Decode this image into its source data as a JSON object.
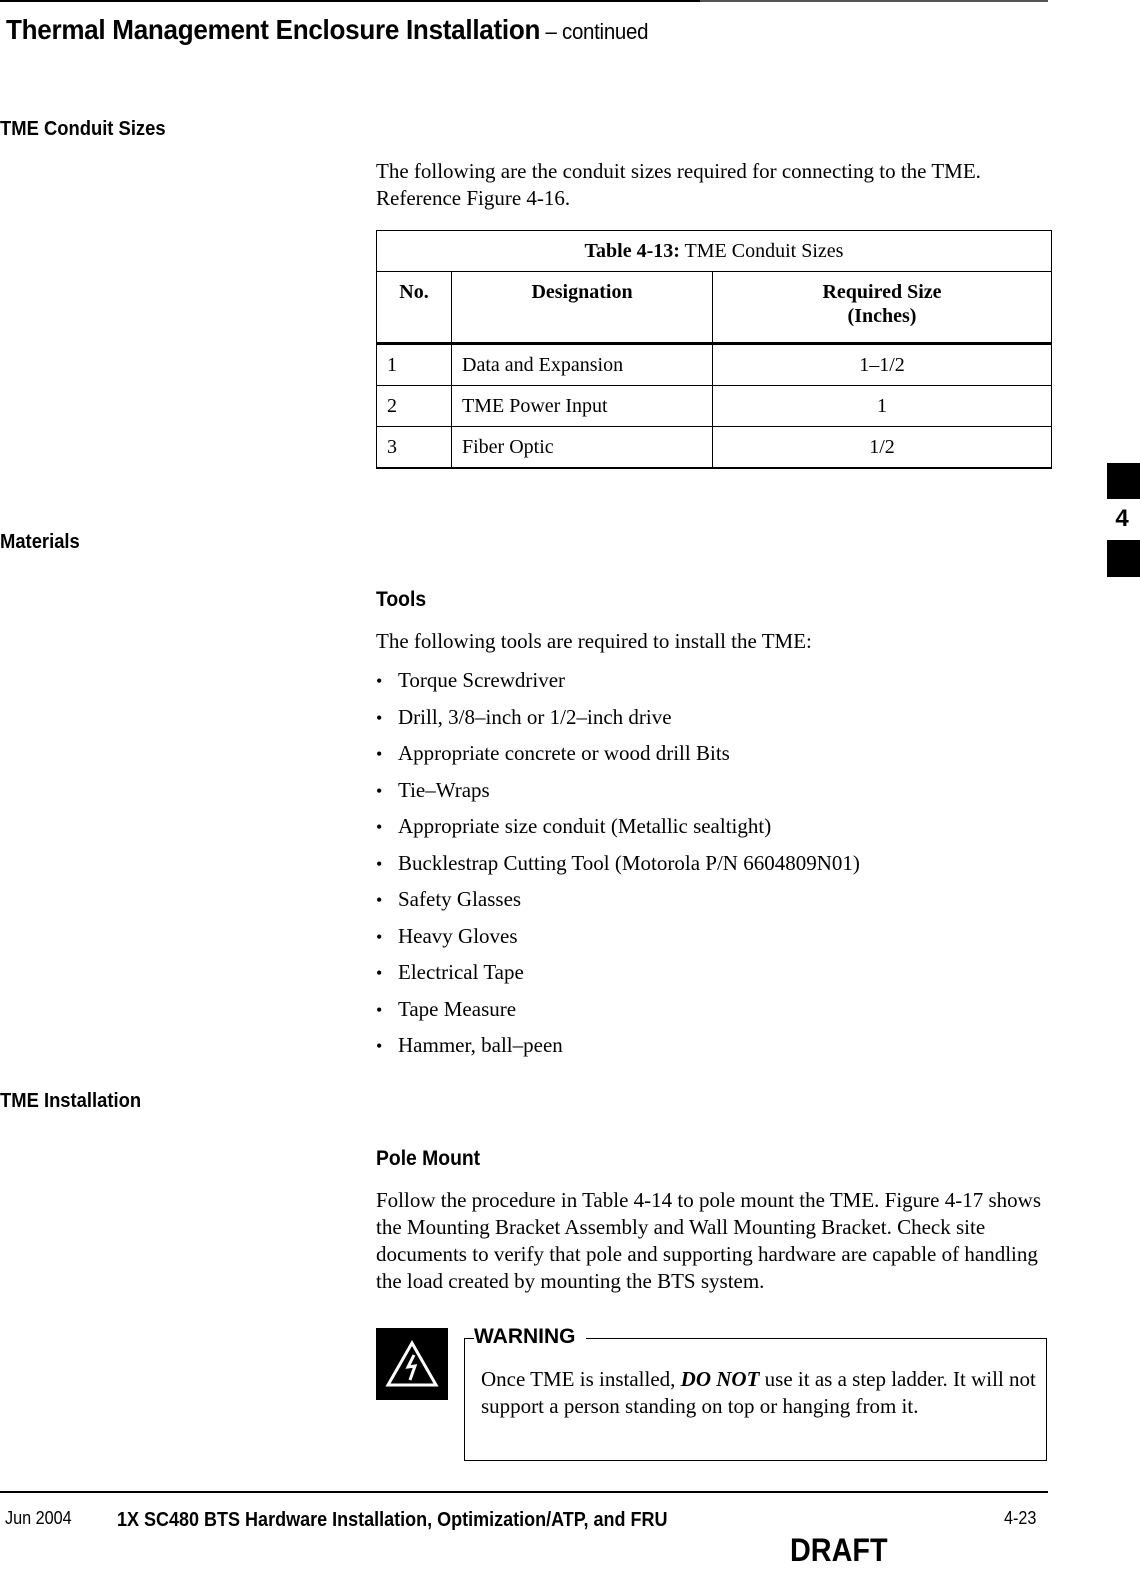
{
  "header": {
    "title": "Thermal Management Enclosure Installation",
    "continued": " – continued"
  },
  "sections": {
    "conduit": {
      "heading": "TME Conduit Sizes",
      "intro": "The following are the conduit sizes required for connecting to the TME. Reference Figure 4-16.",
      "table": {
        "caption_label": "Table 4-13:",
        "caption_text": " TME Conduit Sizes",
        "columns": [
          "No.",
          "Designation",
          "Required Size",
          "(Inches)"
        ],
        "rows": [
          {
            "no": "1",
            "designation": "Data and Expansion",
            "size": "1–1/2"
          },
          {
            "no": "2",
            "designation": "TME Power Input",
            "size": "1"
          },
          {
            "no": "3",
            "designation": "Fiber Optic",
            "size": "1/2"
          }
        ]
      }
    },
    "materials": {
      "heading": "Materials",
      "tools_heading": "Tools",
      "tools_intro": "The following tools are required to install the TME:",
      "tools": [
        "Torque Screwdriver",
        "Drill, 3/8–inch or 1/2–inch drive",
        "Appropriate concrete or wood drill Bits",
        "Tie–Wraps",
        "Appropriate size conduit (Metallic sealtight)",
        "Bucklestrap Cutting Tool (Motorola P/N 6604809N01)",
        "Safety Glasses",
        "Heavy Gloves",
        "Electrical Tape",
        "Tape Measure",
        "Hammer, ball–peen"
      ],
      "bullet": "•"
    },
    "installation": {
      "heading": "TME Installation",
      "pole_heading": "Pole Mount",
      "pole_text": "Follow the procedure in Table 4-14 to pole mount the TME. Figure 4-17 shows the Mounting Bracket Assembly and Wall Mounting Bracket. Check site documents to verify that pole and supporting hardware are capable of handling the load created by mounting the BTS system."
    },
    "warning": {
      "label": "WARNING",
      "icon": "electrical-hazard-icon",
      "text_before": "Once TME is installed, ",
      "text_emphasis": "DO NOT",
      "text_after": " use it as a step ladder. It will not support a person standing on top or hanging from it."
    }
  },
  "side_tab": {
    "chapter": "4"
  },
  "footer": {
    "date": "Jun 2004",
    "doc_title": "1X SC480 BTS Hardware Installation, Optimization/ATP, and FRU",
    "page": "4-23",
    "status": "DRAFT"
  }
}
